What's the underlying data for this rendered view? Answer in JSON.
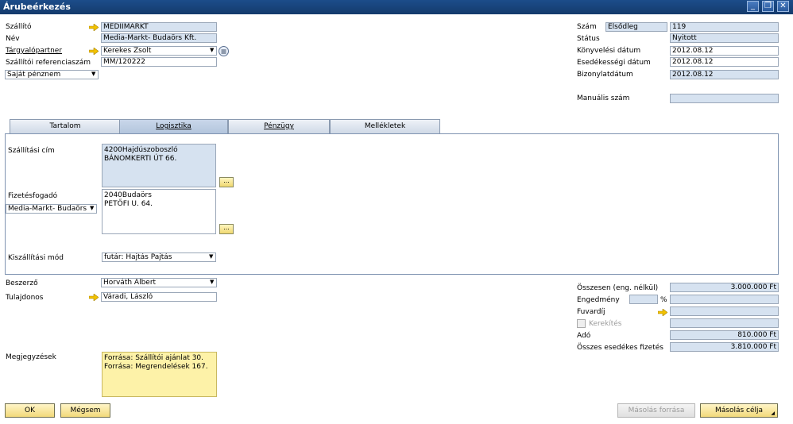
{
  "window": {
    "title": "Árubeérkezés"
  },
  "header_left": {
    "szallito_label": "Szállító",
    "szallito_value": "MEDIIMARKT",
    "nev_label": "Név",
    "nev_value": "Media-Markt- Budaörs Kft.",
    "targyalo_label": "Tárgyalópartner",
    "targyalo_value": "Kerekes Zsolt",
    "ref_label": "Szállítói referenciaszám",
    "ref_value": "MM/120222",
    "currency_value": "Saját pénznem"
  },
  "header_right": {
    "szam_label": "Szám",
    "szam_series": "Elsődleg",
    "szam_value": "119",
    "status_label": "Státus",
    "status_value": "Nyitott",
    "konyv_label": "Könyvelési dátum",
    "konyv_value": "2012.08.12",
    "esed_label": "Esedékességi dátum",
    "esed_value": "2012.08.12",
    "biz_label": "Bizonylatdátum",
    "biz_value": "2012.08.12",
    "manual_label": "Manuális szám",
    "manual_value": ""
  },
  "tabs": [
    {
      "label": "Tartalom"
    },
    {
      "label": "Logisztika"
    },
    {
      "label": "Pénzügy"
    },
    {
      "label": "Mellékletek"
    }
  ],
  "logistics": {
    "ship_label": "Szállítási cím",
    "ship_line1": "4200Hajdúszoboszló",
    "ship_line2": "BÁNOMKERTI ÚT 66.",
    "payee_label": "Fizetésfogadó",
    "payee_select": "Media-Markt- Budaörs",
    "payee_line1": "2040Budaörs",
    "payee_line2": "PETŐFI U. 64.",
    "delivery_label": "Kiszállítási mód",
    "delivery_value": "futár: Hajtás Pajtás"
  },
  "footer_left": {
    "buyer_label": "Beszerző",
    "buyer_value": "Horváth Albert",
    "owner_label": "Tulajdonos",
    "owner_value": "Váradi, László",
    "notes_label": "Megjegyzések",
    "notes_line1": "Forrása: Szállítói ajánlat 30.",
    "notes_line2": "Forrása: Megrendelések 167."
  },
  "totals": {
    "net_label": "Összesen (eng. nélkül)",
    "net_value": "3.000.000 Ft",
    "discount_label": "Engedmény",
    "discount_pct": "%",
    "freight_label": "Fuvardíj",
    "rounding_label": "Kerekítés",
    "tax_label": "Adó",
    "tax_value": "810.000 Ft",
    "total_label": "Összes esedékes fizetés",
    "total_value": "3.810.000 Ft"
  },
  "buttons": {
    "ok": "OK",
    "cancel": "Mégsem",
    "copy_from": "Másolás forrása",
    "copy_to": "Másolás célja"
  }
}
